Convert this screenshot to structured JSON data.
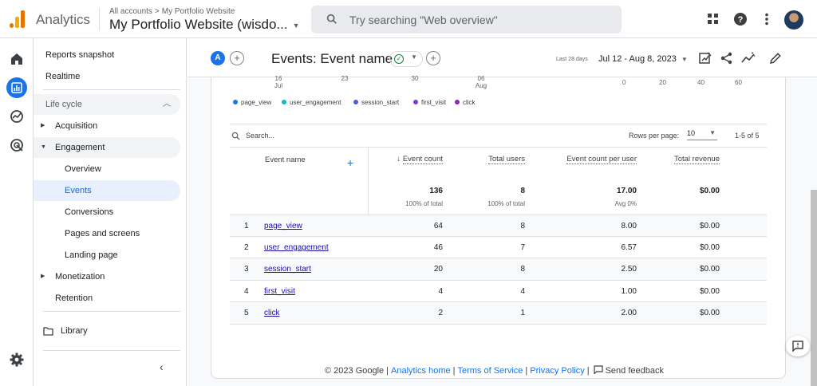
{
  "app": {
    "title": "Analytics"
  },
  "account": {
    "breadcrumb": [
      "All accounts",
      "My Portfolio Website"
    ],
    "property_name": "My Portfolio Website (wisdo..."
  },
  "search": {
    "placeholder": "Try searching \"Web overview\""
  },
  "sidenav": {
    "items": [
      {
        "label": "Reports snapshot"
      },
      {
        "label": "Realtime"
      },
      {
        "label": "Life cycle"
      },
      {
        "label": "Acquisition"
      },
      {
        "label": "Engagement"
      },
      {
        "label": "Overview"
      },
      {
        "label": "Events"
      },
      {
        "label": "Conversions"
      },
      {
        "label": "Pages and screens"
      },
      {
        "label": "Landing page"
      },
      {
        "label": "Monetization"
      },
      {
        "label": "Retention"
      },
      {
        "label": "Library"
      }
    ]
  },
  "header": {
    "comparison_badge": "A",
    "title": "Events: Event name",
    "date_label": "Last 28 days",
    "date_range": "Jul 12 - Aug 8, 2023"
  },
  "chart_data": {
    "type": "line",
    "x_ticks": [
      {
        "top": "16",
        "bottom": "Jul"
      },
      {
        "top": "23",
        "bottom": ""
      },
      {
        "top": "30",
        "bottom": ""
      },
      {
        "top": "06",
        "bottom": "Aug"
      }
    ],
    "y_ticks": [
      "0",
      "20",
      "40",
      "60"
    ],
    "series": [
      {
        "name": "page_view",
        "color": "#1a73e8"
      },
      {
        "name": "user_engagement",
        "color": "#12b5cb"
      },
      {
        "name": "session_start",
        "color": "#4a5bd4"
      },
      {
        "name": "first_visit",
        "color": "#7b3fc9"
      },
      {
        "name": "click",
        "color": "#8e24aa"
      }
    ]
  },
  "table": {
    "search_placeholder": "Search...",
    "rows_per_page_label": "Rows per page:",
    "rows_per_page": "10",
    "pagination": "1-5 of 5",
    "columns": {
      "event_name": "Event name",
      "event_count": "Event count",
      "total_users": "Total users",
      "event_count_per_user": "Event count per user",
      "total_revenue": "Total revenue"
    },
    "totals": {
      "event_count": "136",
      "event_count_sub": "100% of total",
      "total_users": "8",
      "total_users_sub": "100% of total",
      "per_user": "17.00",
      "per_user_sub": "Avg 0%",
      "revenue": "$0.00"
    },
    "rows": [
      {
        "idx": "1",
        "name": "page_view",
        "count": "64",
        "users": "8",
        "per_user": "8.00",
        "revenue": "$0.00"
      },
      {
        "idx": "2",
        "name": "user_engagement",
        "count": "46",
        "users": "7",
        "per_user": "6.57",
        "revenue": "$0.00"
      },
      {
        "idx": "3",
        "name": "session_start",
        "count": "20",
        "users": "8",
        "per_user": "2.50",
        "revenue": "$0.00"
      },
      {
        "idx": "4",
        "name": "first_visit",
        "count": "4",
        "users": "4",
        "per_user": "1.00",
        "revenue": "$0.00"
      },
      {
        "idx": "5",
        "name": "click",
        "count": "2",
        "users": "1",
        "per_user": "2.00",
        "revenue": "$0.00"
      }
    ]
  },
  "footer": {
    "copyright": "© 2023 Google",
    "analytics_home": "Analytics home",
    "terms": "Terms of Service",
    "privacy": "Privacy Policy",
    "feedback": "Send feedback"
  }
}
